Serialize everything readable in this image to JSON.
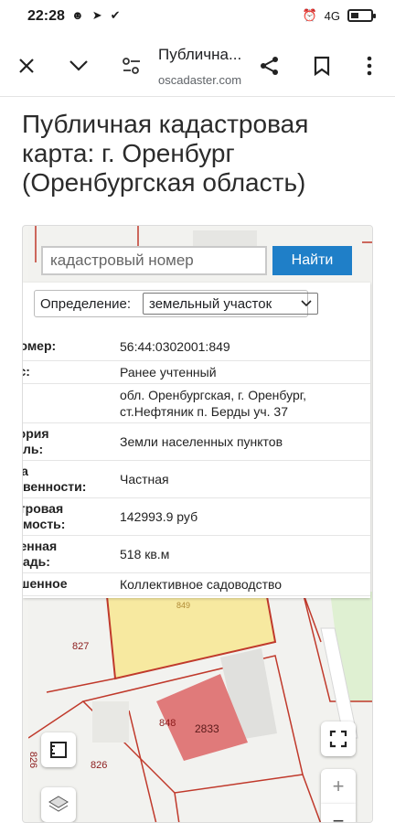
{
  "status_bar": {
    "time": "22:28",
    "signal": "4G"
  },
  "toolbar": {
    "title": "Публична...",
    "url": "oscadaster.com"
  },
  "page": {
    "heading": "Публичная кадастровая карта: г. Оренбург (Оренбургская область)"
  },
  "search": {
    "placeholder": "кадастровый номер",
    "button_label": "Найти"
  },
  "definition": {
    "label": "Определение:",
    "selected": "земельный участок"
  },
  "attributes": [
    {
      "key": "номер:",
      "value": "56:44:0302001:849"
    },
    {
      "key": "ус:",
      "value": "Ранее учтенный"
    },
    {
      "key": "с:",
      "value": "обл. Оренбургская, г. Оренбург, ст.Нефтяник п. Берды уч. 37"
    },
    {
      "key": "тория\nль:",
      "value": "Земли населенных пунктов"
    },
    {
      "key": "ма\nвенности:",
      "value": "Частная"
    },
    {
      "key": "стровая\nмость:",
      "value": "142993.9 руб"
    },
    {
      "key": "ненная\nадь:",
      "value": "518 кв.м"
    },
    {
      "key": "ешенное",
      "value": "Коллективное садоводство"
    }
  ],
  "map_labels": {
    "l827": "827",
    "l848": "848",
    "l2833": "2833",
    "l826": "826",
    "l826b": "826",
    "l849": "849"
  },
  "colors": {
    "accent": "#1f7fc8",
    "parcel_highlight": "#f7e9a0",
    "building_red": "#e07a7a",
    "parcel_border": "#c0392b"
  }
}
